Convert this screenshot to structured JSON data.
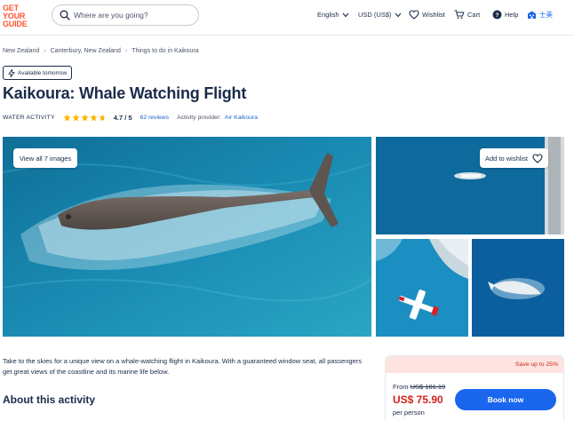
{
  "header": {
    "logo_lines": [
      "GET",
      "YOUR",
      "GUIDE"
    ],
    "search_placeholder": "Where are you going?",
    "language": "English",
    "currency": "USD (US$)",
    "wishlist": "Wishlist",
    "cart": "Cart",
    "help": "Help",
    "profile": "士美"
  },
  "breadcrumb": [
    "New Zealand",
    "Canterbury, New Zealand",
    "Things to do in Kaikoura"
  ],
  "badge": "Available tomorrow",
  "title": "Kaikoura: Whale Watching Flight",
  "meta": {
    "category": "WATER ACTIVITY",
    "rating": "4.7 / 5",
    "stars": 4.7,
    "reviews": "62 reviews",
    "provider_label": "Activity provider:",
    "provider": "Air Kaikoura"
  },
  "gallery": {
    "view_all": "View all 7 images",
    "add_wishlist": "Add to wishlist"
  },
  "description": "Take to the skies for a unique view on a whale-watching flight in Kaikoura. With a guaranteed window seat, all passengers get great views of the coastline and its marine life below.",
  "about_heading": "About this activity",
  "booking": {
    "save": "Save up to 25%",
    "from_label": "From",
    "old_price": "US$ 101.19",
    "price": "US$ 75.90",
    "per": "per person",
    "book_button": "Book now"
  },
  "colors": {
    "brand": "#ff5533",
    "primary_button": "#1a66ed",
    "price_red": "#d2221c",
    "star": "#ffb400",
    "ocean": "#1e7fa8"
  }
}
